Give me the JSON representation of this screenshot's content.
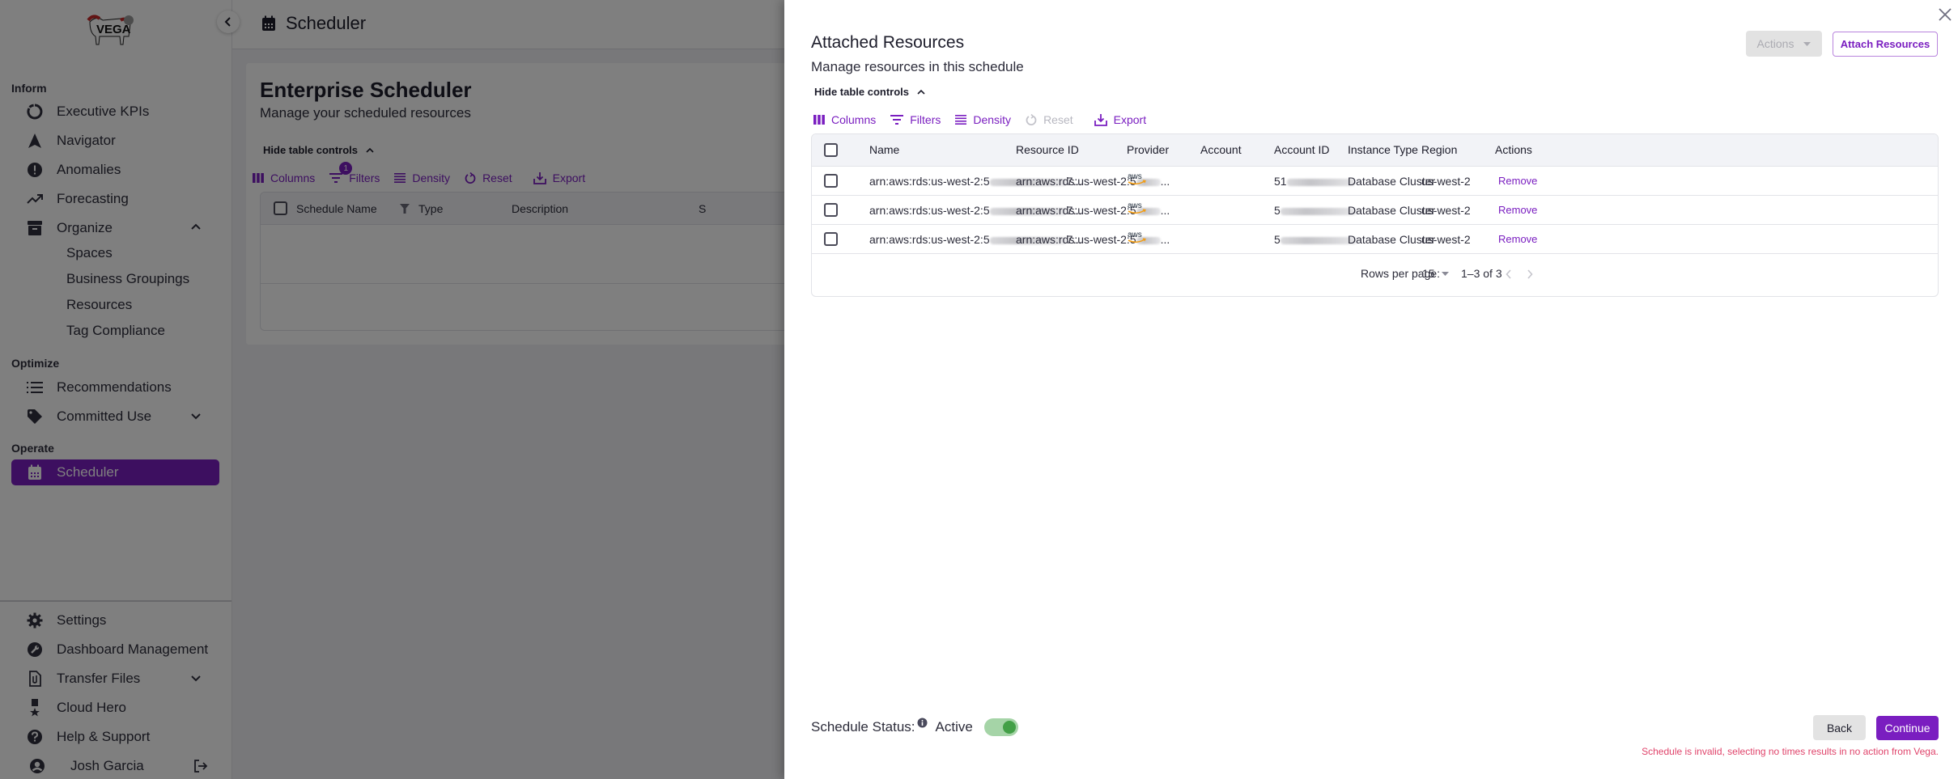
{
  "sidebar": {
    "logo_alt": "Vega",
    "sections": {
      "inform": "Inform",
      "optimize": "Optimize",
      "operate": "Operate"
    },
    "items": {
      "executive_kpis": "Executive KPIs",
      "navigator": "Navigator",
      "anomalies": "Anomalies",
      "forecasting": "Forecasting",
      "organize": "Organize",
      "spaces": "Spaces",
      "business_groupings": "Business Groupings",
      "resources": "Resources",
      "tag_compliance": "Tag Compliance",
      "recommendations": "Recommendations",
      "committed_use": "Committed Use",
      "scheduler": "Scheduler",
      "settings": "Settings",
      "dashboard_management": "Dashboard Management",
      "transfer_files": "Transfer Files",
      "cloud_hero": "Cloud Hero",
      "help_support": "Help & Support"
    },
    "user": {
      "name": "Josh Garcia"
    }
  },
  "topbar": {
    "title": "Scheduler"
  },
  "page": {
    "title": "Enterprise Scheduler",
    "subtitle": "Manage your scheduled resources",
    "hide_controls": "Hide table controls",
    "toolbar": {
      "columns": "Columns",
      "filters": "Filters",
      "filters_badge": "1",
      "density": "Density",
      "reset": "Reset",
      "export": "Export"
    },
    "columns": [
      "Schedule Name",
      "Type",
      "Description",
      "S"
    ]
  },
  "drawer": {
    "title": "Attached Resources",
    "subtitle": "Manage resources in this schedule",
    "actions_label": "Actions",
    "attach_label": "Attach Resources",
    "hide_controls": "Hide table controls",
    "toolbar": {
      "columns": "Columns",
      "filters": "Filters",
      "density": "Density",
      "reset": "Reset",
      "export": "Export"
    },
    "columns": {
      "name": "Name",
      "resource_id": "Resource ID",
      "provider": "Provider",
      "account": "Account",
      "account_id": "Account ID",
      "instance_type": "Instance Type",
      "region": "Region",
      "actions": "Actions"
    },
    "rows": [
      {
        "name_prefix": "arn:aws:rds:us-west-2:5",
        "name_suffix": "7...",
        "resource_id_prefix": "arn:aws:rds:us-west-2:5",
        "resource_id_suffix": "...",
        "provider": "aws",
        "account": "",
        "account_id_prefix": "51",
        "instance_type": "Database Cluster",
        "region": "us-west-2",
        "action": "Remove"
      },
      {
        "name_prefix": "arn:aws:rds:us-west-2:5",
        "name_suffix": "7...",
        "resource_id_prefix": "arn:aws:rds:us-west-2:5",
        "resource_id_suffix": "...",
        "provider": "aws",
        "account": "",
        "account_id_prefix": "5",
        "instance_type": "Database Cluster",
        "region": "us-west-2",
        "action": "Remove"
      },
      {
        "name_prefix": "arn:aws:rds:us-west-2:5",
        "name_suffix": "7...",
        "resource_id_prefix": "arn:aws:rds:us-west-2:5",
        "resource_id_suffix": "...",
        "provider": "aws",
        "account": "",
        "account_id_prefix": "5",
        "instance_type": "Database Cluster",
        "region": "us-west-2",
        "action": "Remove"
      }
    ],
    "pagination": {
      "rows_per_page_label": "Rows per page:",
      "rows_per_page": "15",
      "range": "1–3 of 3"
    },
    "status_label": "Schedule Status:",
    "status_value": "Active",
    "status_active": true,
    "back_label": "Back",
    "continue_label": "Continue",
    "error": "Schedule is invalid, selecting no times results in no action from Vega."
  },
  "colors": {
    "accent": "#7a1ec0",
    "toggle_on": "#43a047",
    "error": "#e0446b",
    "aws_orange": "#f39c12"
  }
}
